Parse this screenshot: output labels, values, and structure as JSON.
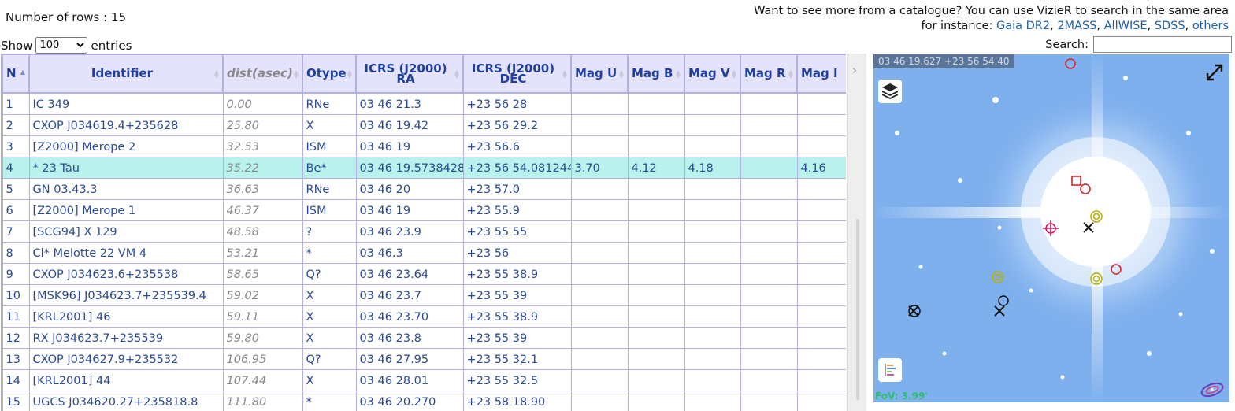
{
  "header": {
    "rows_count": "Number of rows : 15",
    "vizier_line": "Want to see more from a catalogue? You can use VizieR to search in the same area",
    "instance_prefix": "for instance:",
    "links": [
      "Gaia DR2",
      "2MASS",
      "AllWISE",
      "SDSS",
      "others"
    ]
  },
  "controls": {
    "show_label": "Show",
    "entries_label": "entries",
    "page_length": "100",
    "search_label": "Search:",
    "search_value": ""
  },
  "table": {
    "columns": [
      "N",
      "Identifier",
      "dist(asec)",
      "Otype",
      "ICRS (J2000) RA",
      "ICRS (J2000) DEC",
      "Mag U",
      "Mag B",
      "Mag V",
      "Mag R",
      "Mag I"
    ],
    "columns_split": {
      "ra_line1": "ICRS (J2000)",
      "ra_line2": "RA",
      "dec_line1": "ICRS (J2000)",
      "dec_line2": "DEC"
    },
    "selected_row": "4",
    "rows": [
      [
        "1",
        "IC 349",
        "0.00",
        "RNe",
        "03 46 21.3",
        "+23 56 28",
        "",
        "",
        "",
        "",
        ""
      ],
      [
        "2",
        "CXOP J034619.4+235628",
        "25.80",
        "X",
        "03 46 19.42",
        "+23 56 29.2",
        "",
        "",
        "",
        "",
        ""
      ],
      [
        "3",
        "[Z2000] Merope 2",
        "32.53",
        "ISM",
        "03 46 19",
        "+23 56.6",
        "",
        "",
        "",
        "",
        ""
      ],
      [
        "4",
        "* 23 Tau",
        "35.22",
        "Be*",
        "03 46 19.5738428",
        "+23 56 54.081244",
        "3.70",
        "4.12",
        "4.18",
        "",
        "4.16"
      ],
      [
        "5",
        "GN 03.43.3",
        "36.63",
        "RNe",
        "03 46 20",
        "+23 57.0",
        "",
        "",
        "",
        "",
        ""
      ],
      [
        "6",
        "[Z2000] Merope 1",
        "46.37",
        "ISM",
        "03 46 19",
        "+23 55.9",
        "",
        "",
        "",
        "",
        ""
      ],
      [
        "7",
        "[SCG94] X 129",
        "48.58",
        "?",
        "03 46 23.9",
        "+23 55 55",
        "",
        "",
        "",
        "",
        ""
      ],
      [
        "8",
        "Cl* Melotte 22 VM 4",
        "53.21",
        "*",
        "03 46.3",
        "+23 56",
        "",
        "",
        "",
        "",
        ""
      ],
      [
        "9",
        "CXOP J034623.6+235538",
        "58.65",
        "Q?",
        "03 46 23.64",
        "+23 55 38.9",
        "",
        "",
        "",
        "",
        ""
      ],
      [
        "10",
        "[MSK96] J034623.7+235539.4",
        "59.02",
        "X",
        "03 46 23.7",
        "+23 55 39",
        "",
        "",
        "",
        "",
        ""
      ],
      [
        "11",
        "[KRL2001] 46",
        "59.11",
        "X",
        "03 46 23.70",
        "+23 55 38.9",
        "",
        "",
        "",
        "",
        ""
      ],
      [
        "12",
        "RX J034623.7+235539",
        "59.80",
        "X",
        "03 46 23.8",
        "+23 55 39",
        "",
        "",
        "",
        "",
        ""
      ],
      [
        "13",
        "CXOP J034627.9+235532",
        "106.95",
        "Q?",
        "03 46 27.95",
        "+23 55 32.1",
        "",
        "",
        "",
        "",
        ""
      ],
      [
        "14",
        "[KRL2001] 44",
        "107.44",
        "X",
        "03 46 28.01",
        "+23 55 32.5",
        "",
        "",
        "",
        "",
        ""
      ],
      [
        "15",
        "UGCS J034620.27+235818.8",
        "111.80",
        "*",
        "03 46 20.270",
        "+23 58 18.90",
        "",
        "",
        "",
        "",
        ""
      ]
    ]
  },
  "aladin": {
    "coords": "03 46 19.627 +23 56 54.40",
    "fov": "FoV: 3.99'",
    "icons": [
      "layers-icon",
      "fullscreen-icon",
      "stack-icon",
      "galaxy-logo-icon"
    ]
  },
  "colors": {
    "header_bg": "#e4e3fb",
    "header_text": "#1f3f9e",
    "link": "#1f5fa8",
    "selected_row": "#b9f1ec",
    "sky_bg": "#7fb0ee"
  }
}
